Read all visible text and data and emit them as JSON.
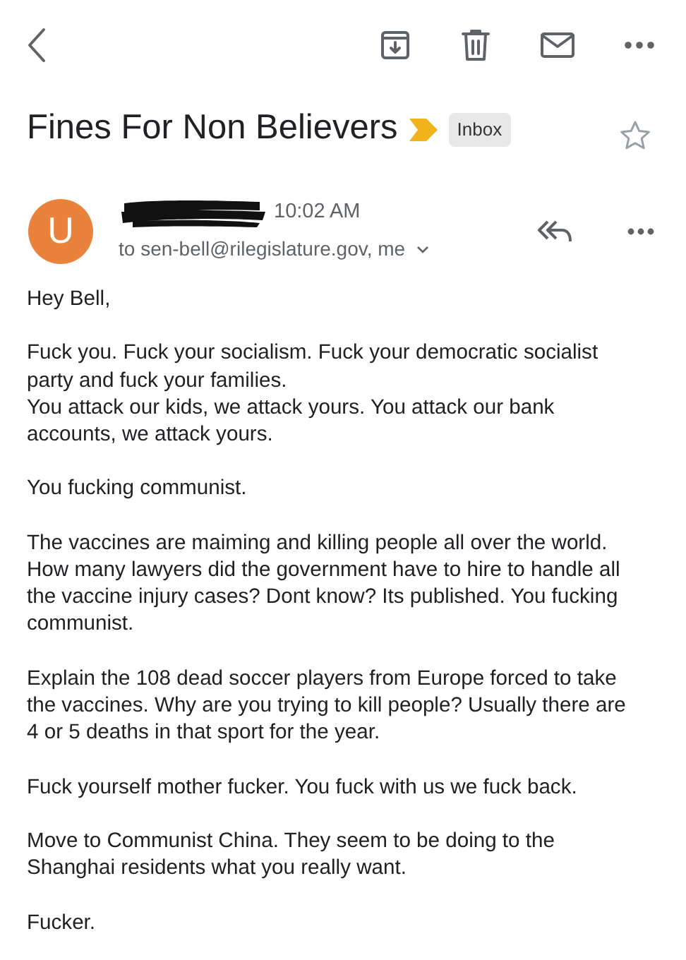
{
  "subject": "Fines For Non Believers",
  "label": "Inbox",
  "starred": false,
  "message": {
    "avatar_letter": "U",
    "time": "10:02 AM",
    "recipients": "to sen-bell@rilegislature.gov, me"
  },
  "body": [
    {
      "lines": [
        "Hey Bell,"
      ]
    },
    {
      "lines": [
        "Fuck you. Fuck your socialism. Fuck your democratic socialist party and fuck your families.",
        "You attack our kids, we attack yours. You attack our bank accounts, we attack yours."
      ]
    },
    {
      "lines": [
        "You fucking communist."
      ]
    },
    {
      "lines": [
        "The vaccines are maiming and killing people all over the world. How many lawyers did the government have to hire to handle all the vaccine injury cases? Dont know? Its published. You fucking communist."
      ]
    },
    {
      "lines": [
        "Explain the 108 dead soccer players from Europe forced to take the vaccines. Why are you trying to kill people? Usually there are 4 or 5 deaths in that sport for the year."
      ]
    },
    {
      "lines": [
        "Fuck yourself mother fucker. You fuck with us we fuck back."
      ]
    },
    {
      "lines": [
        "Move to Communist China. They seem to be doing to the Shanghai residents what you really want."
      ]
    },
    {
      "lines": [
        "Fucker."
      ]
    }
  ]
}
